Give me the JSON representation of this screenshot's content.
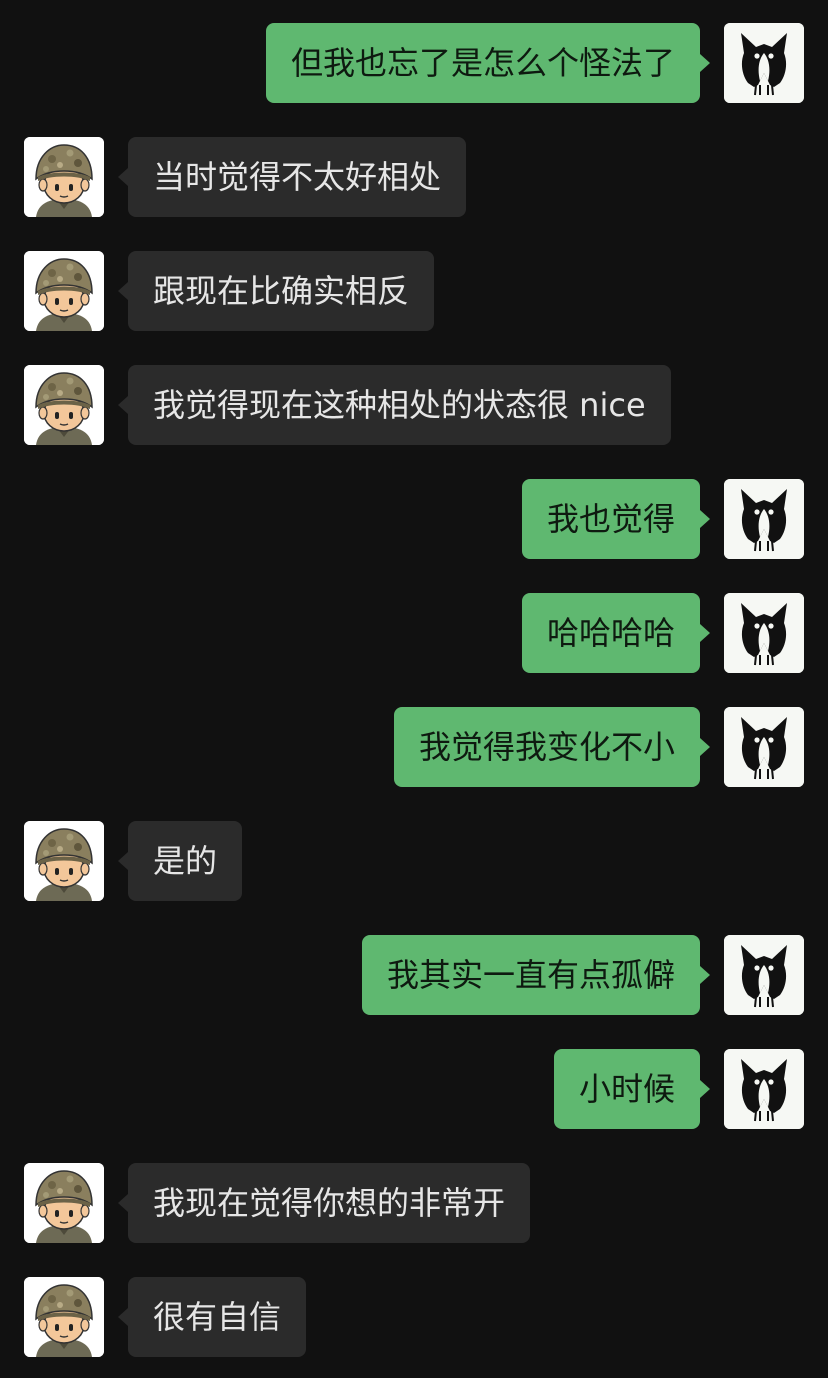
{
  "theme": {
    "background": "#111111",
    "me_bubble": "#5fb870",
    "other_bubble": "#2b2b2b"
  },
  "avatars": {
    "me": "cat-silhouette-avatar",
    "other": "soldier-helmet-avatar"
  },
  "messages": [
    {
      "from": "me",
      "text": "但我也忘了是怎么个怪法了"
    },
    {
      "from": "other",
      "text": "当时觉得不太好相处"
    },
    {
      "from": "other",
      "text": "跟现在比确实相反"
    },
    {
      "from": "other",
      "text": "我觉得现在这种相处的状态很 nice"
    },
    {
      "from": "me",
      "text": "我也觉得"
    },
    {
      "from": "me",
      "text": "哈哈哈哈"
    },
    {
      "from": "me",
      "text": "我觉得我变化不小"
    },
    {
      "from": "other",
      "text": "是的"
    },
    {
      "from": "me",
      "text": "我其实一直有点孤僻"
    },
    {
      "from": "me",
      "text": "小时候"
    },
    {
      "from": "other",
      "text": "我现在觉得你想的非常开"
    },
    {
      "from": "other",
      "text": "很有自信"
    }
  ]
}
